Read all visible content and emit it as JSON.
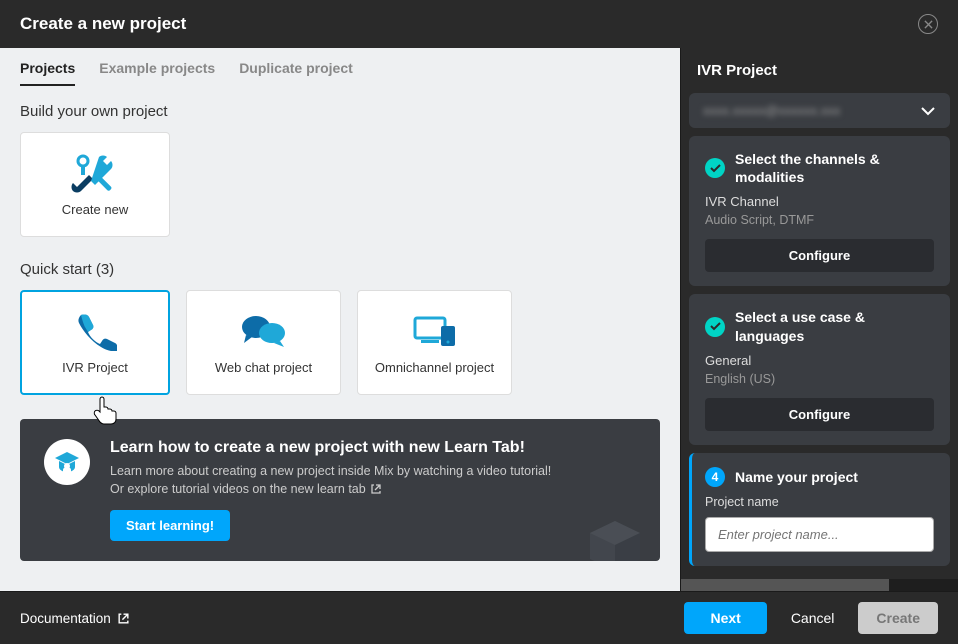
{
  "header": {
    "title": "Create a new project"
  },
  "tabs": {
    "projects": "Projects",
    "examples": "Example projects",
    "duplicate": "Duplicate project"
  },
  "left": {
    "build_title": "Build your own project",
    "create_new": "Create new",
    "quick_start_title": "Quick start (3)",
    "cards": {
      "ivr": "IVR Project",
      "webchat": "Web chat project",
      "omni": "Omnichannel project"
    },
    "learn": {
      "title": "Learn how to create a new project with new Learn Tab!",
      "desc1": "Learn more about creating a new project inside Mix by watching a video tutorial!",
      "desc2": "Or explore tutorial videos on the new learn tab",
      "button": "Start learning!"
    }
  },
  "right": {
    "title": "IVR Project",
    "dropdown_blur": "xxxx.xxxxx@xxxxxx.xxx",
    "step_channels": {
      "title": "Select the channels & modalities",
      "sub": "IVR Channel",
      "sub2": "Audio Script, DTMF",
      "btn": "Configure"
    },
    "step_usecase": {
      "title": "Select a use case & languages",
      "sub": "General",
      "sub2": "English (US)",
      "btn": "Configure"
    },
    "step_name": {
      "num": "4",
      "title": "Name your project",
      "label": "Project name",
      "placeholder": "Enter project name..."
    }
  },
  "footer": {
    "doc": "Documentation",
    "next": "Next",
    "cancel": "Cancel",
    "create": "Create"
  }
}
